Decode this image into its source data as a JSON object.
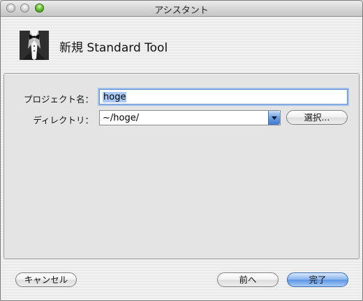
{
  "window": {
    "title": "アシスタント"
  },
  "header": {
    "title": "新規 Standard Tool",
    "logo_icon": "tuxedo-icon"
  },
  "form": {
    "project_name_label": "プロジェクト名：",
    "project_name_value": "hoge",
    "directory_label": "ディレクトリ：",
    "directory_value": "~/hoge/",
    "select_button": "選択..."
  },
  "footer": {
    "cancel_button": "キャンセル",
    "back_button": "前へ",
    "finish_button": "完了"
  },
  "colors": {
    "accent": "#5b94e3",
    "focus_ring": "#9ec1f0"
  }
}
